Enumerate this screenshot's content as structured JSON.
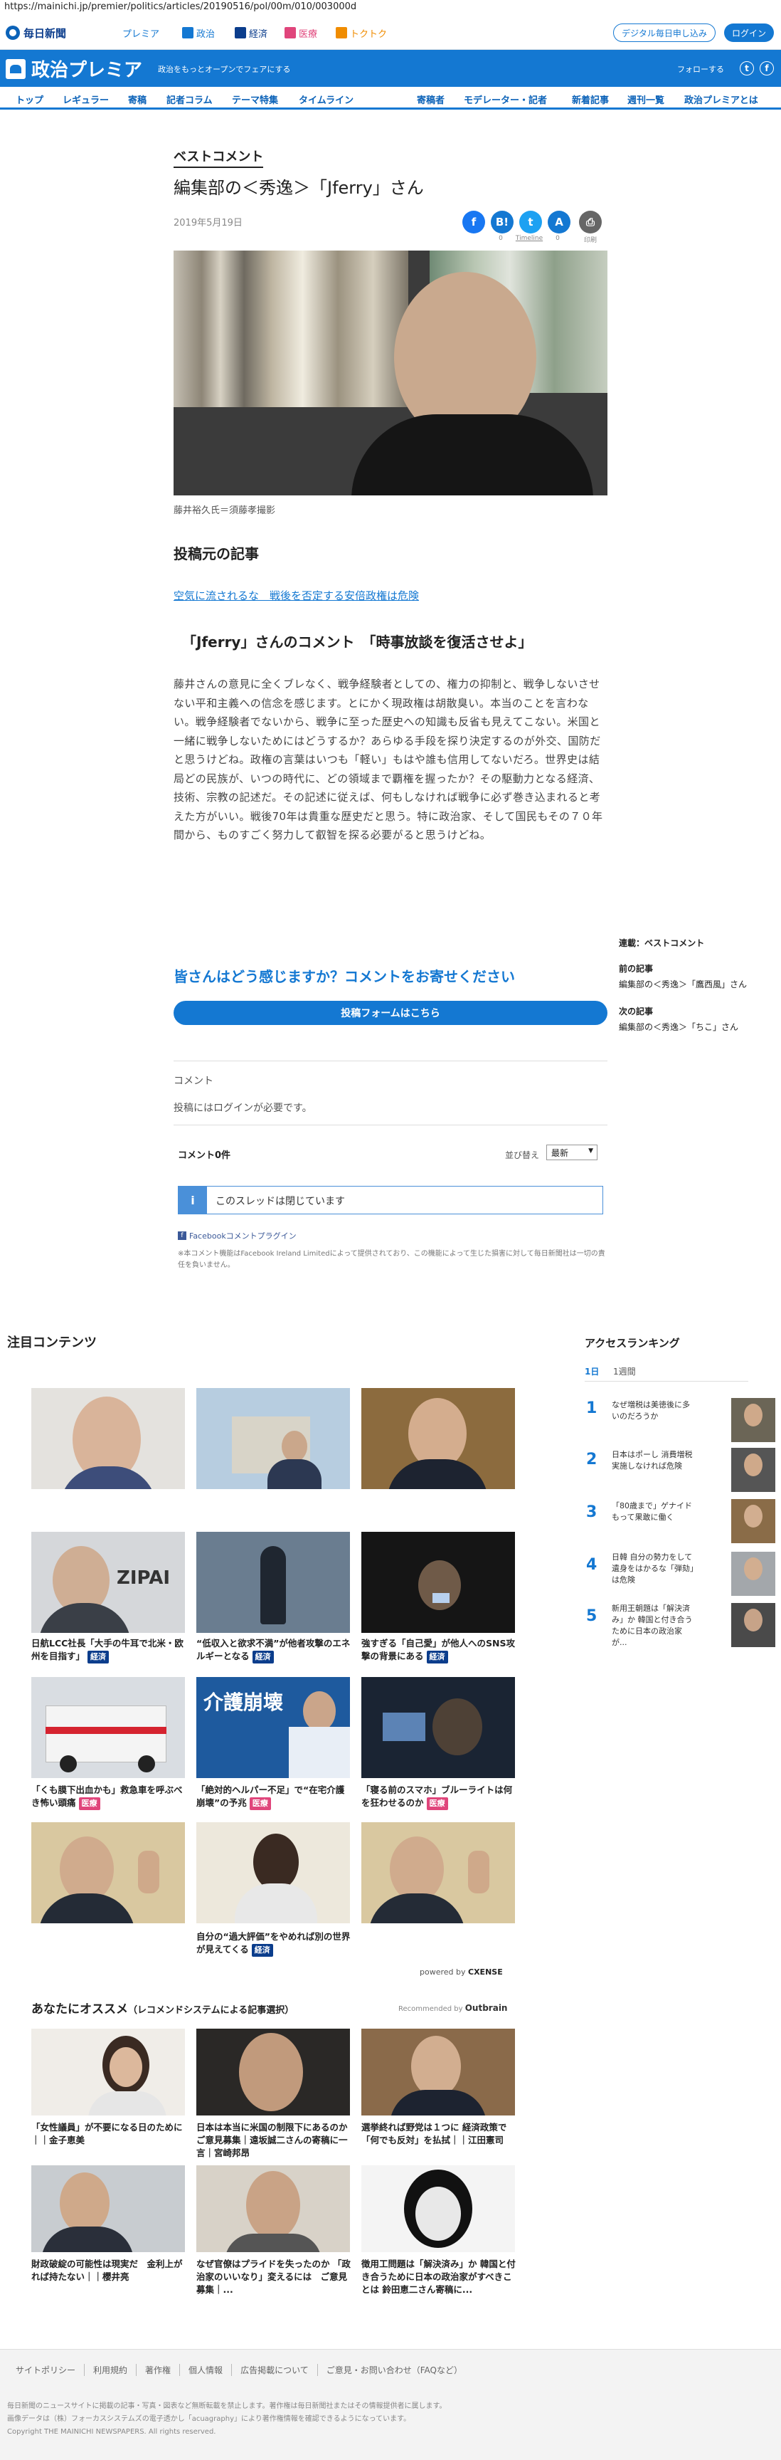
{
  "browser": {
    "url": "https://mainichi.jp/premier/politics/articles/20190516/pol/00m/010/003000d"
  },
  "topbar": {
    "logo": "毎日新聞",
    "services": [
      {
        "label": "プレミア",
        "color": "#1478d2"
      },
      {
        "label": "政治",
        "color": "#1478d2"
      },
      {
        "label": "経済",
        "color": "#0b3d8c"
      },
      {
        "label": "医療",
        "color": "#e0457b"
      },
      {
        "label": "トクトク",
        "color": "#f08c00"
      }
    ],
    "subscribe": "デジタル毎日申し込み",
    "login": "ログイン"
  },
  "header": {
    "brand": "政治プレミア",
    "tagline": "政治をもっとオープンでフェアにする",
    "follow": "フォローする"
  },
  "nav": [
    "トップ",
    "レギュラー",
    "寄稿",
    "記者コラム",
    "テーマ特集",
    "タイムライン",
    "寄稿者",
    "モデレーター・記者",
    "新着記事",
    "週刊一覧",
    "政治プレミアとは"
  ],
  "article": {
    "category": "ベストコメント",
    "title": "編集部の＜秀逸＞「Jferry」さん",
    "date": "2019年5月19日",
    "share_labels": [
      "",
      "0",
      "Timeline",
      "0",
      "印刷"
    ],
    "photo_caption": "藤井裕久氏＝須藤孝撮影",
    "source_heading": "投稿元の記事",
    "source_link": "空気に流されるな　戦後を否定する安倍政権は危険",
    "comment_heading": "「Jferry」さんのコメント　「時事放談を復活させよ」",
    "body": "藤井さんの意見に全くブレなく、戦争経験者としての、権力の抑制と、戦争しないさせない平和主義への信念を感じます。とにかく現政権は胡散臭い。本当のことを言わない。戦争経験者でないから、戦争に至った歴史への知識も反省も見えてこない。米国と一緒に戦争しないためにはどうするか？あらゆる手段を探り決定するのが外交、国防だと思うけどね。政権の言葉はいつも「軽い」もはや誰も信用してないだろ。世界史は結局どの民族が、いつの時代に、どの領域まで覇権を握ったか？その駆動力となる経済、技術、宗教の記述だ。その記述に従えば、何もしなければ戦争に必ず巻き込まれると考えた方がいい。戦後70年は貴重な歴史だと思う。特に政治家、そして国民もその７０年間から、ものすごく努力して叡智を探る必要がると思うけどね。",
    "cta": "皆さんはどう感じますか？コメントをお寄せください",
    "cta_button": "投稿フォームはこちら",
    "comment_label": "コメント",
    "login_needed": "投稿にはログインが必要です。",
    "comment_count": "コメント0件",
    "sort_label": "並び替え",
    "sort_value": "最新",
    "thread_closed": "このスレッドは閉じています",
    "fb_plugin": "Facebookコメントプラグイン",
    "disclaimer": "※本コメント機能はFacebook Ireland Limitedによって提供されており、この機能によって生じた損害に対して毎日新聞社は一切の責任を負いません。"
  },
  "sidebar": {
    "series": "連載：ベストコメント",
    "prev_label": "前の記事",
    "prev_title": "編集部の＜秀逸＞「鷹西風」さん",
    "next_label": "次の記事",
    "next_title": "編集部の＜秀逸＞「ちこ」さん"
  },
  "featured": {
    "heading": "注目コンテンツ",
    "cards": [
      {
        "text": ""
      },
      {
        "text": ""
      },
      {
        "text": ""
      },
      {
        "text": "日航LCC社長「大手の牛耳で北米・欧州を目指す」",
        "badge": "経済",
        "badge_color": "#0b3d8c"
      },
      {
        "text": "“低収入と欲求不満”が他者攻撃のエネルギーとなる",
        "badge": "経済",
        "badge_color": "#0b3d8c"
      },
      {
        "text": "強すぎる「自己愛」が他人へのSNS攻撃の背景にある",
        "badge": "経済",
        "badge_color": "#0b3d8c"
      },
      {
        "text": "「くも膜下出血かも」救急車を呼ぶべき怖い頭痛",
        "badge": "医療",
        "badge_color": "#e0457b"
      },
      {
        "text": "「絶対的ヘルパー不足」で“在宅介護崩壊”の予兆",
        "badge": "医療",
        "badge_color": "#e0457b"
      },
      {
        "text": "「寝る前のスマホ」ブルーライトは何を狂わせるのか",
        "badge": "医療",
        "badge_color": "#e0457b"
      },
      {
        "text": ""
      },
      {
        "text": "自分の“過大評価”をやめれば別の世界が見えてくる",
        "badge": "経済",
        "badge_color": "#0b3d8c"
      },
      {
        "text": ""
      }
    ],
    "banner_text": "介護崩壊",
    "powered": "powered by",
    "powered_brand": "CXENSE"
  },
  "ranking": {
    "heading": "アクセスランキング",
    "tabs": [
      "1日",
      "1週間"
    ],
    "items": [
      {
        "n": "1",
        "text": "なぜ増税は美徳後に多いのだろうか"
      },
      {
        "n": "2",
        "text": "日本はポーし 消費増税実施しなければ危険"
      },
      {
        "n": "3",
        "text": "「80歳まで」ゲナイドもって果敢に働く"
      },
      {
        "n": "4",
        "text": "日韓 自分の勢力をして遺身をはかるな「弾劾」は危険"
      },
      {
        "n": "5",
        "text": "新用王朝題は「解決済み」か 韓国と付き合うために日本の政治家が..."
      }
    ]
  },
  "recommend": {
    "heading": "あなたにオススメ",
    "sub": "（レコメンドシステムによる記事選択）",
    "by": "Recommended by",
    "brand": "Outbrain",
    "items": [
      {
        "text": "「女性議員」が不要になる日のために｜｜金子恵美"
      },
      {
        "text": "日本は本当に米国の制限下にあるのか　ご意見募集｜遠坂誠二さんの寄稿に一言｜宮崎邦昂"
      },
      {
        "text": "選挙終れば野党は１つに 経済政策で「何でも反対」を払拭｜｜江田憲司"
      },
      {
        "text": "財政破綻の可能性は現実だ　金利上がれば持たない｜｜櫻井亮"
      },
      {
        "text": "なぜ官僚はプライドを失ったのか 「政治家のいいなり」変えるには　ご意見募集｜..."
      },
      {
        "text": "徴用工問題は「解決済み」か 韓国と付き合うために日本の政治家がすべきことは 鈴田恵二さん寄稿に..."
      }
    ]
  },
  "footer": {
    "links": [
      "サイトポリシー",
      "利用規約",
      "著作権",
      "個人情報",
      "広告掲載について",
      "ご意見・お問い合わせ（FAQなど）"
    ],
    "note1": "毎日新聞のニュースサイトに掲載の記事・写真・図表など無断転載を禁止します。著作権は毎日新聞社またはその情報提供者に属します。",
    "note2": "画像データは（株）フォーカスシステムズの電子透かし「acuagraphy」により著作権情報を確認できるようになっています。",
    "copyright": "Copyright THE MAINICHI NEWSPAPERS. All rights reserved."
  }
}
